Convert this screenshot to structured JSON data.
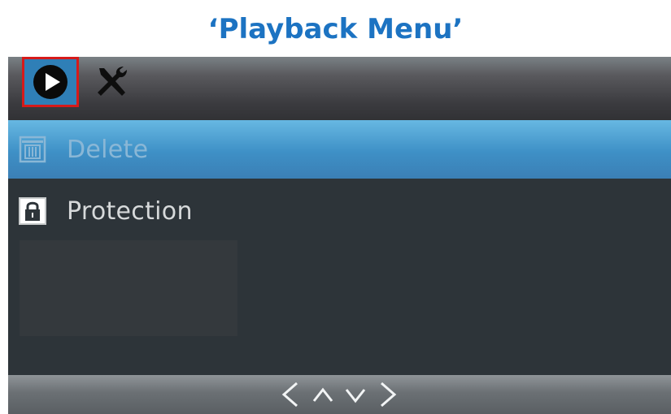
{
  "title": "‘Playback Menu’",
  "tabs": [
    {
      "name": "play-icon",
      "selected": true
    },
    {
      "name": "tools-icon",
      "selected": false
    }
  ],
  "menu": {
    "items": [
      {
        "label": "Delete",
        "icon": "trash-icon",
        "highlighted": true
      },
      {
        "label": "Protection",
        "icon": "lock-icon",
        "highlighted": false
      }
    ]
  },
  "nav": {
    "icons": [
      "chevron-left-icon",
      "chevron-up-icon",
      "chevron-down-icon",
      "chevron-right-icon"
    ]
  },
  "colors": {
    "title": "#1c73c2",
    "highlight": "#3e90c6",
    "selected_tab_border": "#d61a1a",
    "background": "#2d3439"
  }
}
